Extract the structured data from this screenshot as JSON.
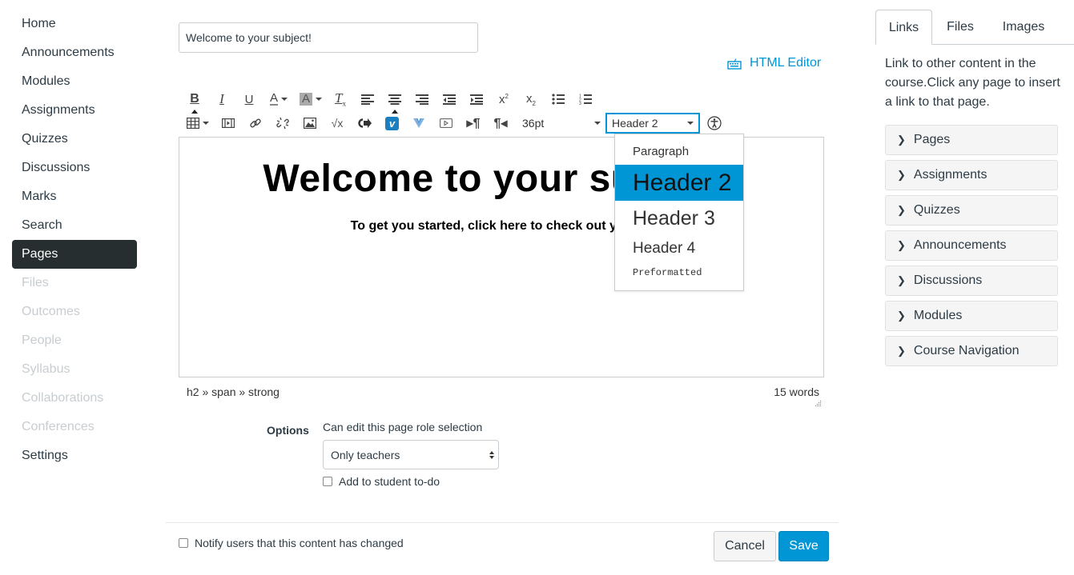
{
  "left_nav": {
    "items": [
      {
        "label": "Home",
        "state": "enabled"
      },
      {
        "label": "Announcements",
        "state": "enabled"
      },
      {
        "label": "Modules",
        "state": "enabled"
      },
      {
        "label": "Assignments",
        "state": "enabled"
      },
      {
        "label": "Quizzes",
        "state": "enabled"
      },
      {
        "label": "Discussions",
        "state": "enabled"
      },
      {
        "label": "Marks",
        "state": "enabled"
      },
      {
        "label": "Search",
        "state": "enabled"
      },
      {
        "label": "Pages",
        "state": "active"
      },
      {
        "label": "Files",
        "state": "disabled"
      },
      {
        "label": "Outcomes",
        "state": "disabled"
      },
      {
        "label": "People",
        "state": "disabled"
      },
      {
        "label": "Syllabus",
        "state": "disabled"
      },
      {
        "label": "Collaborations",
        "state": "disabled"
      },
      {
        "label": "Conferences",
        "state": "disabled"
      },
      {
        "label": "Settings",
        "state": "enabled"
      }
    ]
  },
  "editor": {
    "title_value": "Welcome to your subject!",
    "html_editor_label": "HTML Editor",
    "font_size": "36pt",
    "format_selected": "Header 2",
    "format_options": [
      "Paragraph",
      "Header 2",
      "Header 3",
      "Header 4",
      "Preformatted"
    ],
    "content_heading": "Welcome to your subject!",
    "content_paragraph": "To get you started, click here to check out your m",
    "element_path": "h2 » span » strong",
    "word_count": "15 words"
  },
  "options": {
    "label": "Options",
    "role_caption": "Can edit this page role selection",
    "role_selected": "Only teachers",
    "todo_label": "Add to student to-do",
    "todo_checked": false
  },
  "footer": {
    "notify_label": "Notify users that this content has changed",
    "notify_checked": false,
    "cancel_label": "Cancel",
    "save_label": "Save"
  },
  "sidebar": {
    "tabs": [
      "Links",
      "Files",
      "Images"
    ],
    "active_tab": "Links",
    "description": "Link to other content in the course.Click any page to insert a link to that page.",
    "sections": [
      "Pages",
      "Assignments",
      "Quizzes",
      "Announcements",
      "Discussions",
      "Modules",
      "Course Navigation"
    ]
  },
  "colors": {
    "accent": "#0096d6",
    "nav_active_bg": "#262e2f",
    "text": "#2d3b45",
    "disabled_text": "#c7cdd1"
  }
}
